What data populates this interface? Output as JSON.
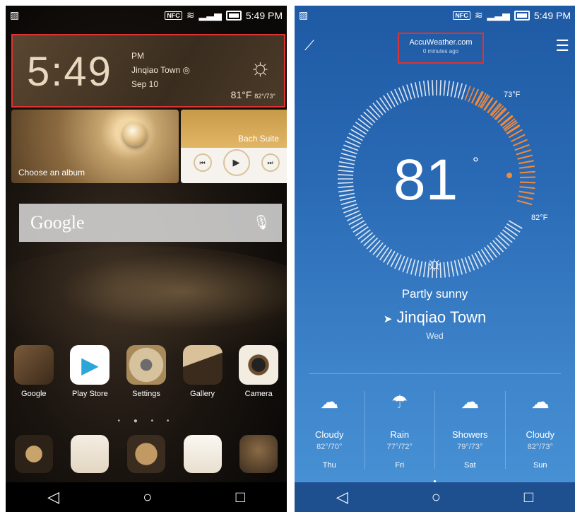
{
  "left": {
    "status": {
      "left_icon": "image-icon",
      "nfc": "NFC",
      "time": "5:49 PM"
    },
    "clock": {
      "time": "5:49",
      "ampm": "PM",
      "location": "Jinqiao Town",
      "date": "Sep 10",
      "temp": "81",
      "unit": "°F",
      "range": "82°/73°"
    },
    "album": {
      "label": "Choose an album"
    },
    "music": {
      "title": "Bach Suite"
    },
    "google": {
      "logo": "Google"
    },
    "apps": [
      {
        "label": "Google"
      },
      {
        "label": "Play Store"
      },
      {
        "label": "Settings"
      },
      {
        "label": "Gallery"
      },
      {
        "label": "Camera"
      }
    ],
    "dots": "• ● • •"
  },
  "right": {
    "status": {
      "left_icon": "image-icon",
      "nfc": "NFC",
      "time": "5:49 PM"
    },
    "provider": {
      "name": "AccuWeather.com",
      "updated": "0 minutes ago"
    },
    "current": {
      "temp": "81",
      "deg": "°",
      "low": "73°F",
      "high": "82°F",
      "condition": "Partly sunny",
      "city": "Jinqiao Town",
      "day": "Wed"
    },
    "forecast": [
      {
        "cond": "Cloudy",
        "range": "82°/70°",
        "day": "Thu",
        "icon": "☁"
      },
      {
        "cond": "Rain",
        "range": "77°/72°",
        "day": "Fri",
        "icon": "☂"
      },
      {
        "cond": "Showers",
        "range": "79°/73°",
        "day": "Sat",
        "icon": "☁"
      },
      {
        "cond": "Cloudy",
        "range": "82°/73°",
        "day": "Sun",
        "icon": "☁"
      }
    ]
  },
  "colors": {
    "accent_orange": "#f28a3a",
    "weather_blue": "#2a6ab5",
    "highlight_red": "#dd3333"
  }
}
